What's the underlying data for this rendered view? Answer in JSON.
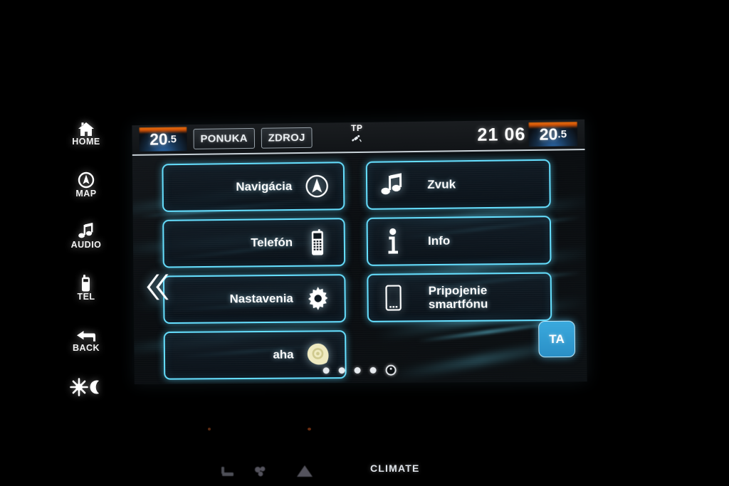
{
  "device": {
    "name": "car-infotainment-head-unit"
  },
  "hardkeys": [
    {
      "label": "HOME",
      "icon": "home-icon"
    },
    {
      "label": "MAP",
      "icon": "map-compass-icon"
    },
    {
      "label": "AUDIO",
      "icon": "music-note-icon"
    },
    {
      "label": "TEL",
      "icon": "phone-handset-icon"
    },
    {
      "label": "BACK",
      "icon": "back-arrow-icon"
    },
    {
      "label": "",
      "icon": "brightness-day-night-icon"
    }
  ],
  "statusbar": {
    "temp_left": {
      "whole": "20",
      "decimal": ".5",
      "full": "20.5"
    },
    "temp_right": {
      "whole": "20",
      "decimal": ".5",
      "full": "20.5"
    },
    "menu_button": "PONUKA",
    "source_button": "ZDROJ",
    "tp_label": "TP",
    "tp_icon": "satellite-icon",
    "clock": "21 06"
  },
  "menu": {
    "prev_arrow_icon": "double-chevron-left-icon",
    "left_column": [
      {
        "label": "Navigácia",
        "icon": "compass-icon"
      },
      {
        "label": "Telefón",
        "icon": "mobile-phone-icon"
      },
      {
        "label": "Nastavenia",
        "icon": "gear-icon"
      },
      {
        "label": "aha",
        "icon": "aha-pin-icon"
      }
    ],
    "right_column": [
      {
        "label": "Zvuk",
        "label2": "",
        "icon": "music-note-icon"
      },
      {
        "label": "Info",
        "label2": "",
        "icon": "info-i-icon"
      },
      {
        "label": "Pripojenie",
        "label2": "smartfónu",
        "icon": "smartphone-icon"
      }
    ],
    "ta_button": "TA",
    "page_dots": {
      "total": 5,
      "current": 5
    }
  },
  "climate": {
    "label": "CLIMATE",
    "icons": [
      "seat-heater-icon",
      "fan-icon",
      "defrost-icon"
    ]
  },
  "colors": {
    "neon_cyan": "#66e0ff",
    "ta_blue": "#3aa9dd",
    "temp_hot": "#ff7a10",
    "temp_cold": "#2f6fb5",
    "text_white": "#ffffff",
    "aha_yellow": "#efeac0",
    "screen_bg": "#0a0d10"
  }
}
